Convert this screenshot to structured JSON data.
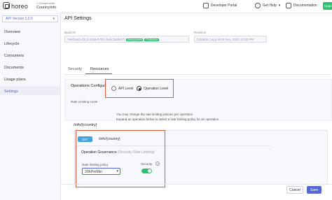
{
  "topbar": {
    "logo_text": "horeo",
    "breadcrumb_parent": "< Components",
    "breadcrumb_current": "CountryInfo",
    "developer_portal": "Developer Portal",
    "get_help": "Get Help",
    "documentation": "Documentation",
    "upgrade": "Upgrade"
  },
  "sidebar": {
    "version": "API Version 1.0.0",
    "items": [
      {
        "label": "Overview"
      },
      {
        "label": "Lifecycle"
      },
      {
        "label": "Consumers"
      },
      {
        "label": "Documents"
      },
      {
        "label": "Usage plans"
      },
      {
        "label": "Settings"
      }
    ]
  },
  "main": {
    "title": "API Settings",
    "build_id_label": "Build ID",
    "build_id_value": "78ef3a62-d3cd-41d8-b75f-15ebc3a0b07f",
    "tag_development": "Development",
    "tag_production": "Production",
    "revision_label": "Revision",
    "revision_value": "Editable Copy of 04 Nov, 2022 12:00 PM",
    "tabs": [
      {
        "label": "Security"
      },
      {
        "label": "Resources"
      }
    ],
    "ops_config_title": "Operations Configuration",
    "rate_limiting_label": "Rate Limiting Level",
    "api_level": "API Level",
    "operation_level": "Operation Level",
    "hint_1": "You may change the rate limiting policies per operation",
    "hint_2": "Expand an operation below to select a rate limiting policy for an operation",
    "resource_path": "/info/{country}",
    "method": "GET",
    "operation_path": "/info/{country}",
    "governance_title": "Operation Governance",
    "governance_sub": "(Security, Rate Limiting)",
    "policy_label": "Rate limiting policy",
    "policy_value": "20KPerMin",
    "security_label": "Security",
    "security_enabled": true,
    "cancel": "Cancel",
    "save": "Save"
  },
  "colors": {
    "accent": "#5567d5",
    "success": "#2fbf71",
    "highlight": "#e8573b",
    "method_get": "#40a2e3"
  }
}
